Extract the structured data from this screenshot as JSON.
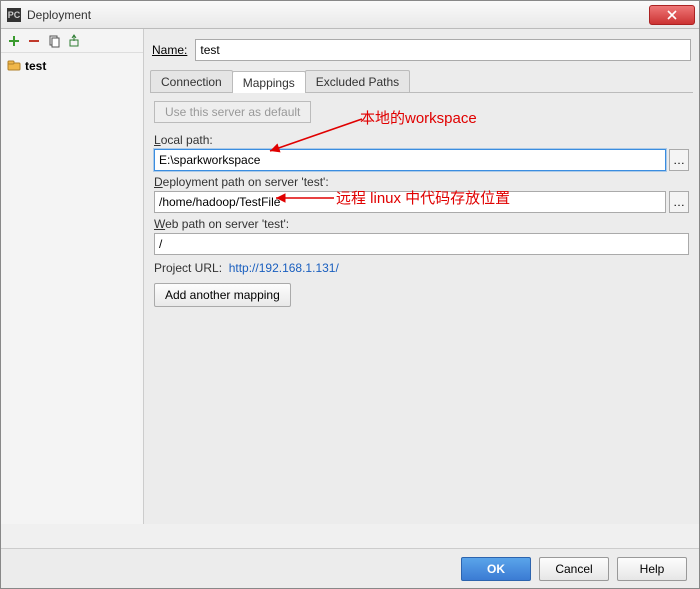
{
  "window": {
    "title": "Deployment"
  },
  "toolbar": {
    "add_color": "#3a9b2e",
    "remove_color": "#c0392b"
  },
  "tree": {
    "items": [
      {
        "label": "test"
      }
    ]
  },
  "form": {
    "name_label": "Name:",
    "name_value": "test"
  },
  "tabs": {
    "connection": "Connection",
    "mappings": "Mappings",
    "excluded": "Excluded Paths",
    "active": "mappings"
  },
  "mappings": {
    "default_btn": "Use this server as default",
    "local_label": "Local path:",
    "local_value": "E:\\sparkworkspace",
    "deploy_label": "Deployment path on server 'test':",
    "deploy_value": "/home/hadoop/TestFile",
    "web_label": "Web path on server 'test':",
    "web_value": "/",
    "project_url_label": "Project URL:",
    "project_url_value": "http://192.168.1.131/",
    "add_mapping": "Add another mapping"
  },
  "annotations": {
    "local": "本地的workspace",
    "remote": "远程 linux 中代码存放位置"
  },
  "buttons": {
    "ok": "OK",
    "cancel": "Cancel",
    "help": "Help"
  },
  "browse_glyph": "…"
}
